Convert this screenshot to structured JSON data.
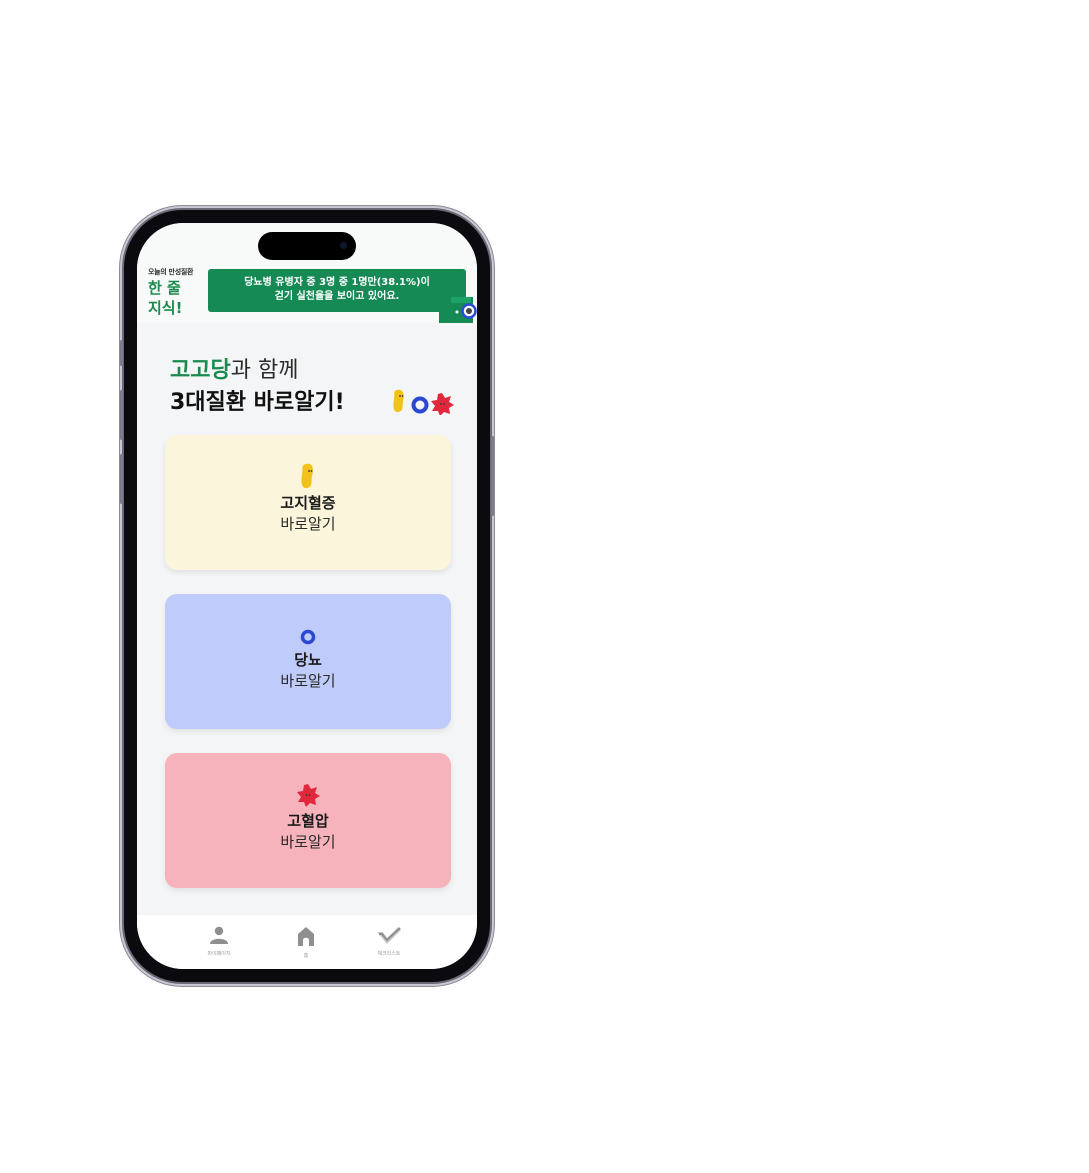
{
  "header": {
    "brand_small": "오늘의 만성질환",
    "brand_line1": "한 줄",
    "brand_line2": "지식!",
    "banner_line1": "당뇨병 유병자 중 3명 중 1명만(38.1%)이",
    "banner_line2": "걷기 실천율을 보이고 있어요."
  },
  "headline": {
    "accent": "고고당",
    "line1_rest": "과 함께",
    "line2": "3대질환 바로알기!"
  },
  "cards": [
    {
      "title": "고지혈증",
      "subtitle": "바로알기",
      "color": "#fbf5dc",
      "icon": "yellow-bean-icon"
    },
    {
      "title": "당뇨",
      "subtitle": "바로알기",
      "color": "#bfcbfa",
      "icon": "blue-ring-icon"
    },
    {
      "title": "고혈압",
      "subtitle": "바로알기",
      "color": "#f7b3bb",
      "icon": "red-star-icon"
    }
  ],
  "tabs": [
    {
      "label": "마이페이지",
      "icon": "person-icon"
    },
    {
      "label": "홈",
      "icon": "home-icon"
    },
    {
      "label": "체크리스트",
      "icon": "check-icon"
    }
  ],
  "colors": {
    "brand_green": "#168a55",
    "background": "#f4f5f7"
  }
}
